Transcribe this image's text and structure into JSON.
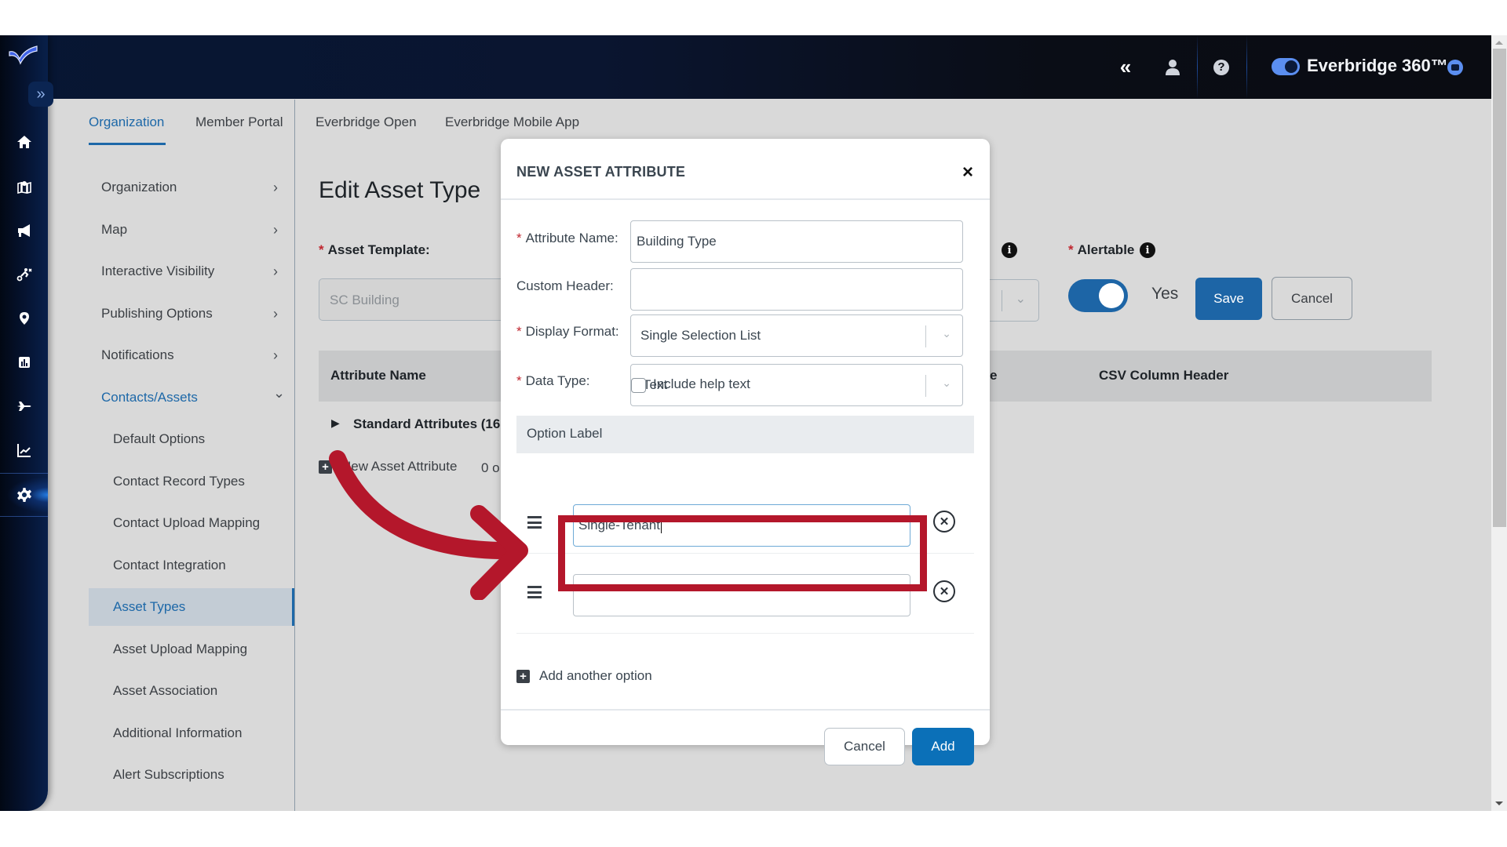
{
  "header": {
    "brand_name": "Everbridge 360™",
    "icons": [
      "collapse-left-icon",
      "user-icon",
      "help-icon",
      "chat-icon"
    ]
  },
  "rail": {
    "items": [
      "home-icon",
      "map-icon",
      "megaphone-icon",
      "incident-icon",
      "location-pin-icon",
      "report-icon",
      "travel-icon",
      "analytics-icon",
      "settings-icon"
    ],
    "active": "settings-icon"
  },
  "tabs": [
    {
      "label": "Organization",
      "active": true
    },
    {
      "label": "Member Portal",
      "active": false
    },
    {
      "label": "Everbridge Open",
      "active": false
    },
    {
      "label": "Everbridge Mobile App",
      "active": false
    }
  ],
  "settings_nav": {
    "items": [
      {
        "label": "Organization",
        "chevron": "›"
      },
      {
        "label": "Map",
        "chevron": "›"
      },
      {
        "label": "Interactive Visibility",
        "chevron": "›"
      },
      {
        "label": "Publishing Options",
        "chevron": "›"
      },
      {
        "label": "Notifications",
        "chevron": "›"
      },
      {
        "label": "Contacts/Assets",
        "chevron": "⌄"
      }
    ],
    "sub_items": [
      "Default Options",
      "Contact Record Types",
      "Contact Upload Mapping",
      "Contact Integration",
      "Asset Types",
      "Asset Upload Mapping",
      "Asset Association",
      "Additional Information",
      "Alert Subscriptions"
    ],
    "selected": "Asset Types"
  },
  "page": {
    "title": "Edit Asset Type",
    "asset_template_label": "Asset Template:",
    "asset_template_value": "SC Building",
    "hidden_field_label_tail": ":",
    "alertable_label": "Alertable",
    "alertable_value": "Yes",
    "alertable_on": true,
    "save_label": "Save",
    "cancel_label": "Cancel",
    "table_headers": [
      "Attribute Name",
      "e",
      "CSV Column Header"
    ],
    "standard_attributes": "Standard Attributes (16",
    "new_attribute_label": "New Asset Attribute",
    "count_text": "0 o"
  },
  "modal": {
    "title": "NEW ASSET ATTRIBUTE",
    "close_label": "×",
    "attribute_name_label": "Attribute Name:",
    "attribute_name_value": "Building Type",
    "custom_header_label": "Custom Header:",
    "custom_header_value": "",
    "display_format_label": "Display Format:",
    "display_format_value": "Single Selection List",
    "data_type_label": "Data Type:",
    "data_type_value": "Text",
    "include_help_text_label": "Include help text",
    "include_help_text_checked": false,
    "option_label_header": "Option Label",
    "options": [
      {
        "value": "Single-Tenant",
        "focused": true
      },
      {
        "value": "",
        "focused": false
      }
    ],
    "add_option_label": "Add another option",
    "cancel_label": "Cancel",
    "add_label": "Add"
  },
  "annotation": {
    "color": "#b4172b",
    "target": "option-1-input"
  },
  "colors": {
    "accent": "#1d65a6",
    "primary_button": "#0b70b8",
    "header_bg": "#0a0c12",
    "annotation": "#b4172b"
  }
}
